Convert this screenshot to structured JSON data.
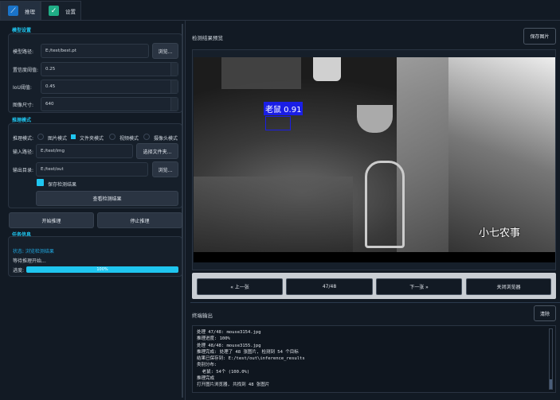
{
  "tabs": [
    {
      "label": "推理",
      "icon": "chart-line-icon",
      "active": true
    },
    {
      "label": "设置",
      "icon": "check-square-icon",
      "active": false
    }
  ],
  "model_settings": {
    "title": "模型设置",
    "model_path_label": "模型路径:",
    "model_path": "E:/test/best.pt",
    "browse": "浏览...",
    "conf_label": "置信度阈值:",
    "conf": "0.25",
    "iou_label": "IoU阈值:",
    "iou": "0.45",
    "size_label": "图像尺寸:",
    "size": "640"
  },
  "inference_mode": {
    "title": "推理模式",
    "mode_label": "推理模式:",
    "modes": [
      {
        "label": "图片模式",
        "checked": false
      },
      {
        "label": "文件夹模式",
        "checked": true
      },
      {
        "label": "视频模式",
        "checked": false
      },
      {
        "label": "摄像头模式",
        "checked": false
      }
    ],
    "input_label": "输入路径:",
    "input_path": "E:/test/img",
    "select_folder": "选择文件夹...",
    "output_label": "输出目录:",
    "output_path": "E:/test/out",
    "browse": "浏览...",
    "save_results_label": "保存检测结果",
    "save_results_checked": true,
    "view_results": "查看检测结果"
  },
  "actions": {
    "start": "开始推理",
    "stop": "停止推理"
  },
  "task_info": {
    "title": "任务信息",
    "status": "状态: 浏览检测结果",
    "waiting": "等待推理开始...",
    "progress_label": "进度:",
    "progress_text": "100%",
    "progress": 100
  },
  "preview": {
    "title": "检测结果预览",
    "save_image": "保存图片",
    "detection_label": "老鼠 0.91",
    "watermark": "小七农事",
    "prev": "« 上一张",
    "counter": "47/48",
    "next": "下一张 »",
    "close": "关闭浏览器"
  },
  "terminal": {
    "title": "终端输出",
    "clear": "清除",
    "lines": [
      "处理 47/48: mouse3154.jpg",
      "推理进度: 100%",
      "处理 48/48: mouse3155.jpg",
      "推理完成: 处理了 48 张图片, 检测到 54 个目标",
      "结果已保存到: E:/test/out\\inference_results",
      "类别分布:",
      "  老鼠: 54个 (100.0%)",
      "推理完成",
      "打开图片浏览器, 共找到 48 张图片"
    ]
  },
  "colors": {
    "accent": "#1fc6f0",
    "background": "#121a24",
    "detection_box": "#1a1ee6"
  }
}
